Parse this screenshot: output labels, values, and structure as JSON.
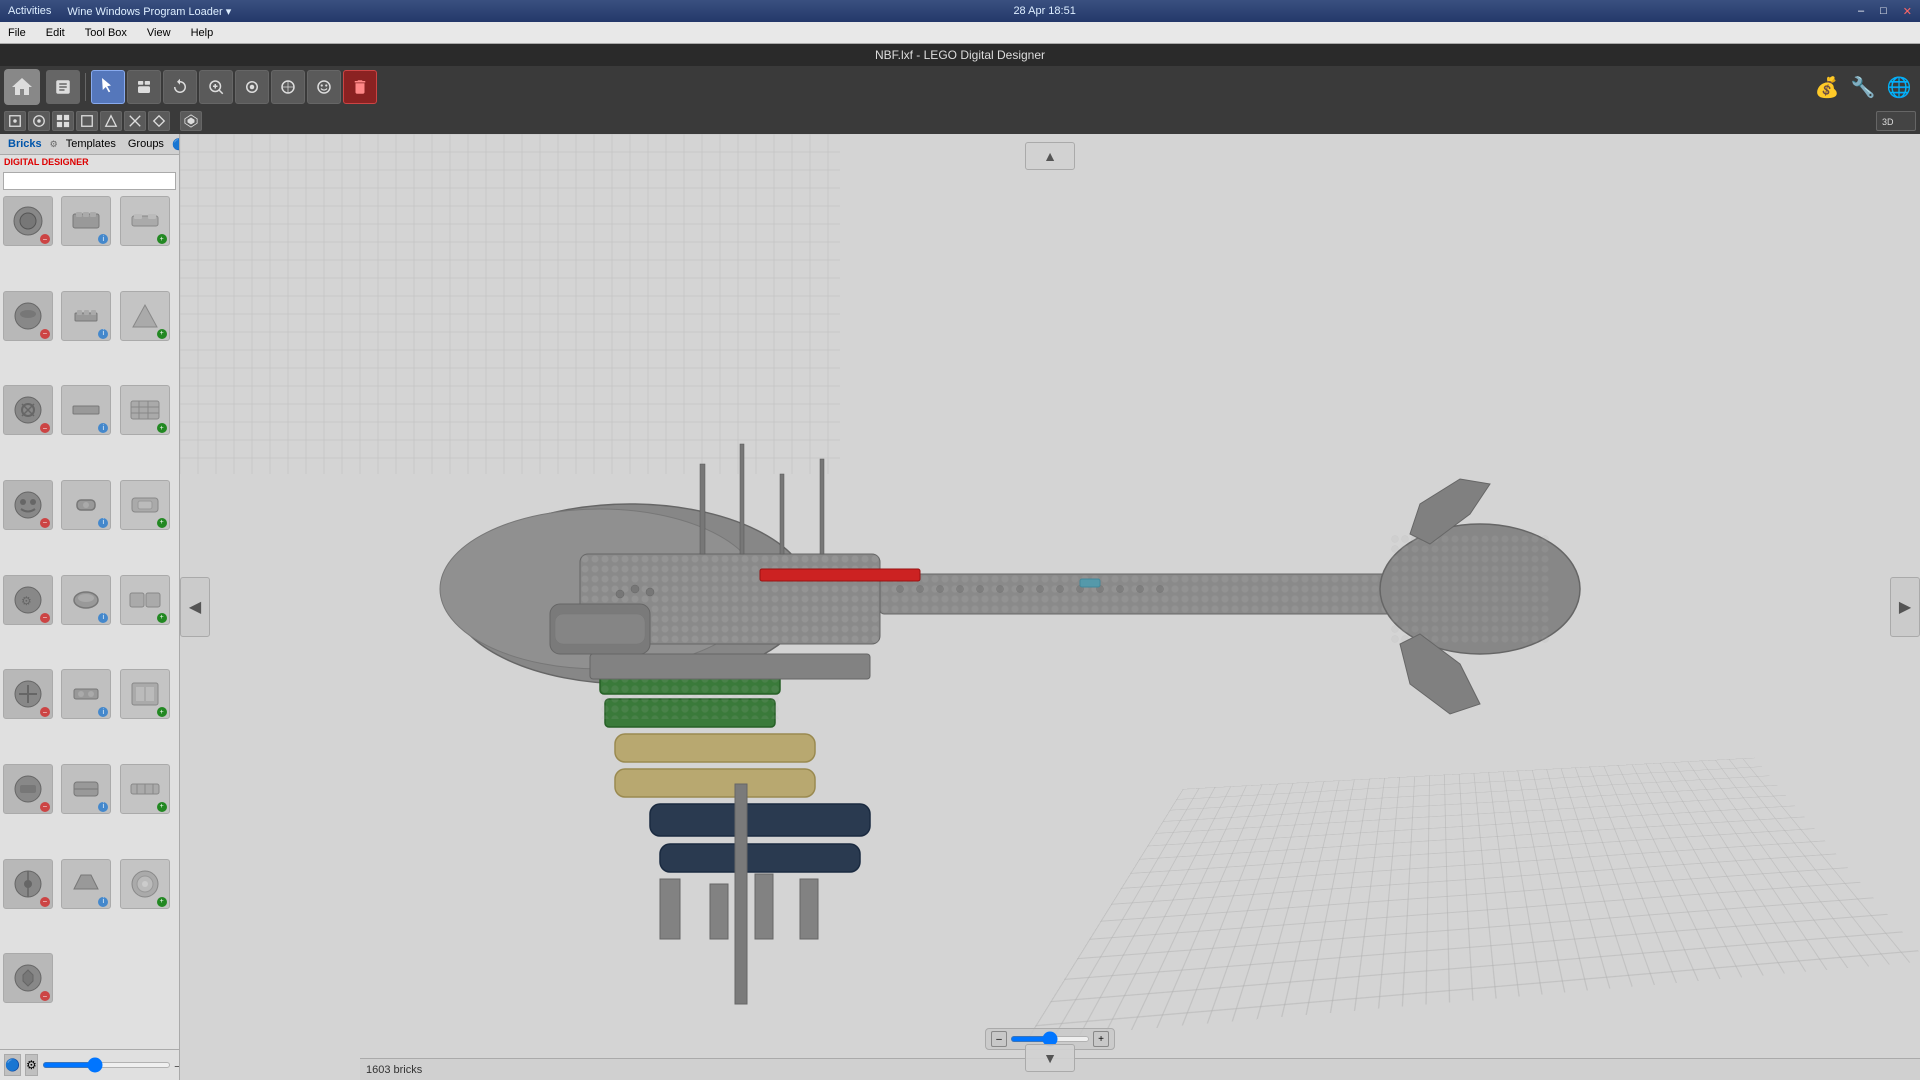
{
  "activity_bar": {
    "items": [
      "Activities",
      "Wine Windows Program Loader ▾"
    ],
    "datetime": "28 Apr  18:51"
  },
  "window": {
    "title": "NBF.lxf - LEGO Digital Designer",
    "close_label": "✕"
  },
  "menu": {
    "items": [
      "File",
      "Edit",
      "Tool Box",
      "View",
      "Help"
    ]
  },
  "toolbar": {
    "buttons": [
      {
        "name": "home",
        "icon": "🏠"
      },
      {
        "name": "select",
        "icon": "↖"
      },
      {
        "name": "pan",
        "icon": "✋"
      },
      {
        "name": "rotate",
        "icon": "↻"
      },
      {
        "name": "zoom",
        "icon": "🔍"
      },
      {
        "name": "paint",
        "icon": "🎨"
      },
      {
        "name": "hinge",
        "icon": "⚙"
      },
      {
        "name": "delete",
        "icon": "✕"
      }
    ]
  },
  "sub_toolbar": {
    "buttons": [
      {
        "name": "sub1",
        "icon": "◉"
      },
      {
        "name": "sub2",
        "icon": "⊙"
      },
      {
        "name": "sub3",
        "icon": "⊛"
      },
      {
        "name": "sub4",
        "icon": "⬚"
      },
      {
        "name": "sub5",
        "icon": "⊞"
      },
      {
        "name": "sub6",
        "icon": "⊟"
      },
      {
        "name": "sub7",
        "icon": "⊠"
      },
      {
        "name": "view3d",
        "icon": "⬡"
      }
    ]
  },
  "left_panel": {
    "tabs": [
      "Bricks",
      "Templates",
      "Groups"
    ],
    "active_tab": "Bricks",
    "logo_text": "DIGITAL DESIGNER",
    "search_placeholder": "",
    "bricks": [
      {
        "shape": "round",
        "color": "#888"
      },
      {
        "shape": "plate",
        "color": "#999"
      },
      {
        "shape": "angled",
        "color": "#aaa"
      },
      {
        "shape": "round2",
        "color": "#888"
      },
      {
        "shape": "flat",
        "color": "#999"
      },
      {
        "shape": "technic",
        "color": "#aaa"
      },
      {
        "shape": "round3",
        "color": "#888"
      },
      {
        "shape": "flat2",
        "color": "#999"
      },
      {
        "shape": "angled2",
        "color": "#aaa"
      },
      {
        "shape": "round4",
        "color": "#888"
      },
      {
        "shape": "flat3",
        "color": "#999"
      },
      {
        "shape": "technic2",
        "color": "#aaa"
      },
      {
        "shape": "round5",
        "color": "#888"
      },
      {
        "shape": "flat4",
        "color": "#999"
      },
      {
        "shape": "angled3",
        "color": "#aaa"
      },
      {
        "shape": "round6",
        "color": "#888"
      },
      {
        "shape": "flat5",
        "color": "#999"
      },
      {
        "shape": "technic3",
        "color": "#aaa"
      },
      {
        "shape": "round7",
        "color": "#888"
      },
      {
        "shape": "flat6",
        "color": "#999"
      },
      {
        "shape": "angled4",
        "color": "#aaa"
      },
      {
        "shape": "round8",
        "color": "#888"
      },
      {
        "shape": "flat7",
        "color": "#999"
      },
      {
        "shape": "technic4",
        "color": "#aaa"
      },
      {
        "shape": "round9",
        "color": "#888"
      },
      {
        "shape": "flat8",
        "color": "#999"
      },
      {
        "shape": "angled5",
        "color": "#aaa"
      },
      {
        "shape": "round10",
        "color": "#888"
      },
      {
        "shape": "flat9",
        "color": "#999"
      },
      {
        "shape": "technic5",
        "color": "#aaa"
      },
      {
        "shape": "round11",
        "color": "#888"
      },
      {
        "shape": "flat10",
        "color": "#999"
      },
      {
        "shape": "angled6",
        "color": "#aaa"
      },
      {
        "shape": "round12",
        "color": "#888"
      },
      {
        "shape": "flat11",
        "color": "#999"
      },
      {
        "shape": "technic6",
        "color": "#aaa"
      }
    ]
  },
  "canvas": {
    "nav_left": "◀",
    "nav_right": "▶",
    "arrow_up": "▲",
    "arrow_down": "▼"
  },
  "status_bar": {
    "brick_count": "1603 bricks"
  },
  "top_right_icons": [
    "💰",
    "🔧",
    "🌐"
  ]
}
